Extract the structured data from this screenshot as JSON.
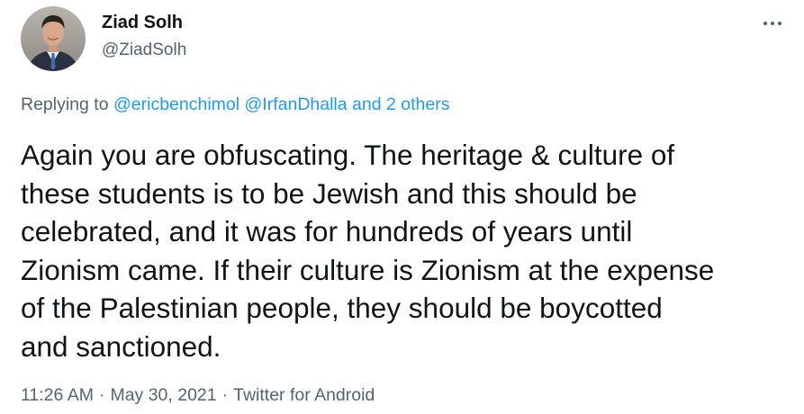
{
  "author": {
    "display_name": "Ziad Solh",
    "handle": "@ZiadSolh",
    "avatar_icon": "profile-photo"
  },
  "menu": {
    "icon": "more-horizontal-icon"
  },
  "replying": {
    "prefix": "Replying to",
    "mention_1": "@ericbenchimol",
    "mention_2": "@IrfanDhalla",
    "others": "and 2 others"
  },
  "tweet": {
    "text": "Again you are obfuscating. The heritage & culture of\nthese students is to be Jewish and this should be\ncelebrated, and it was for hundreds of years until\nZionism came. If their culture is Zionism at the expense\nof the Palestinian people, they should be boycotted\nand sanctioned."
  },
  "meta": {
    "time": "11:26 AM",
    "date": "May 30, 2021",
    "source": "Twitter for Android",
    "separator": "·"
  },
  "colors": {
    "text": "#0f1419",
    "secondary": "#536471",
    "link": "#1d9bf0"
  }
}
